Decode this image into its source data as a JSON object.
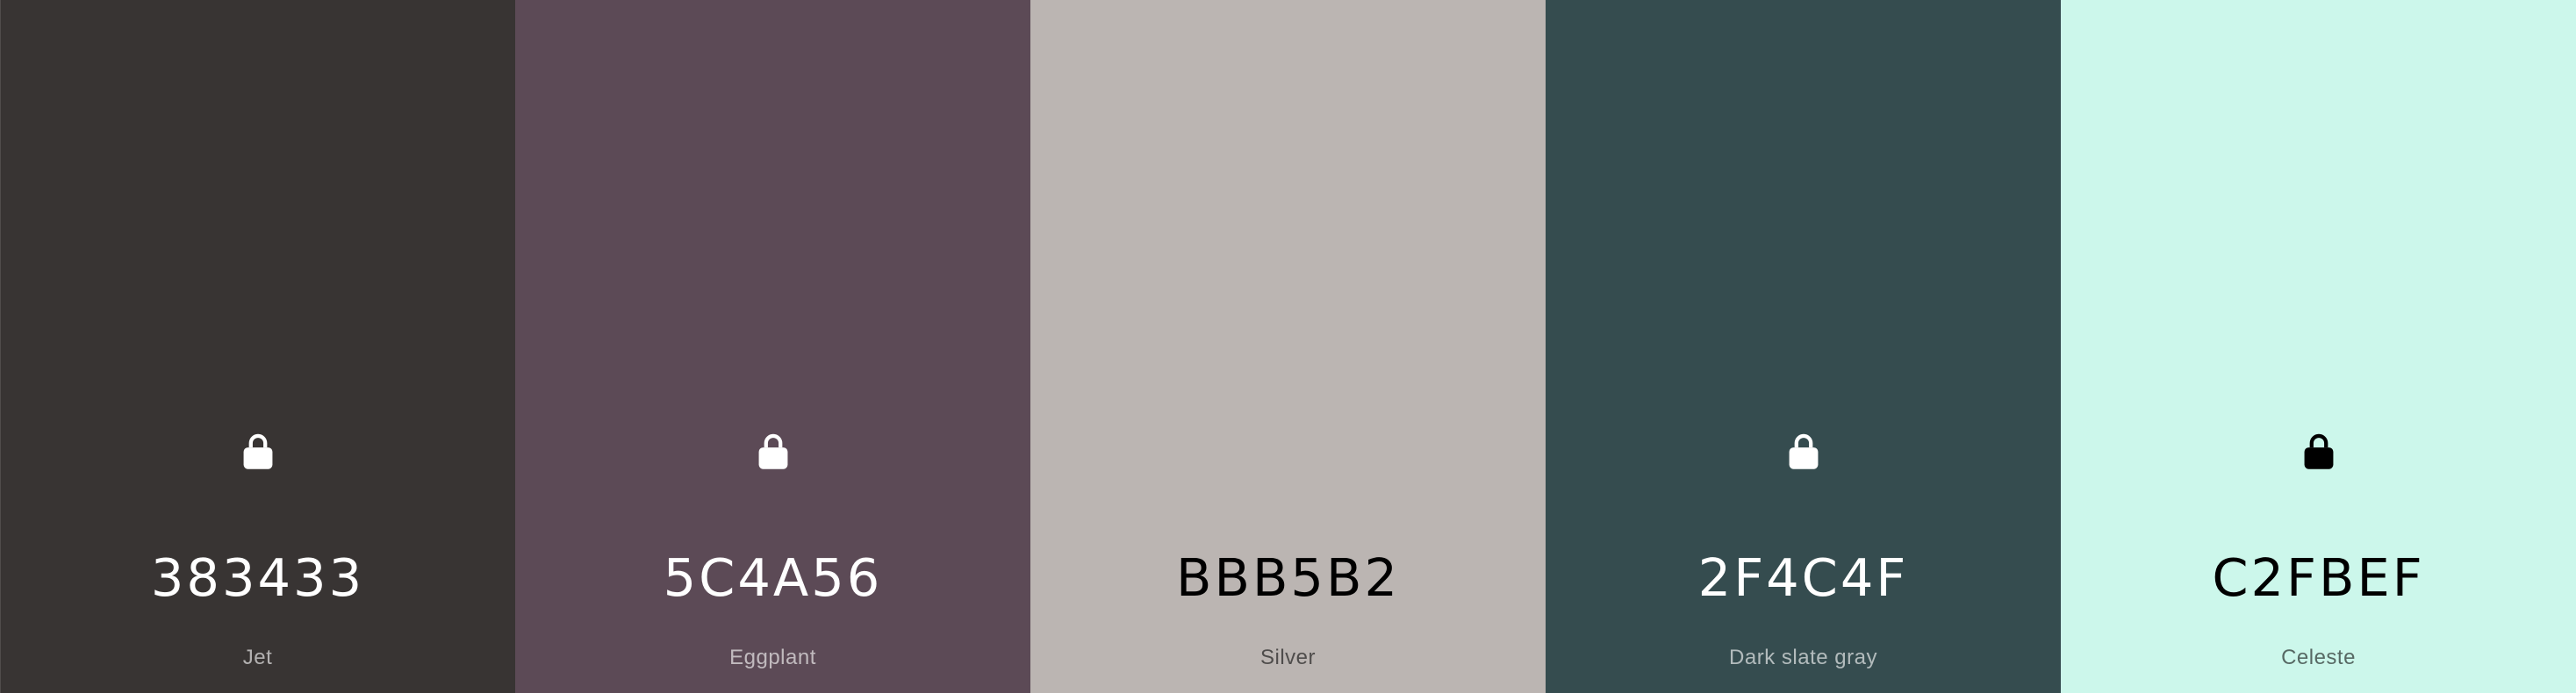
{
  "palette": {
    "colors": [
      {
        "hex": "383433",
        "name": "Jet",
        "bg": "#383433",
        "text_tone": "light",
        "icon": "lock-icon"
      },
      {
        "hex": "5C4A56",
        "name": "Eggplant",
        "bg": "#5C4A56",
        "text_tone": "light",
        "icon": "lock-icon"
      },
      {
        "hex": "BBB5B2",
        "name": "Silver",
        "bg": "#BBB5B2",
        "text_tone": "dark",
        "icon": null
      },
      {
        "hex": "2F4C4F",
        "name": "Dark slate gray",
        "bg": "#354C4F",
        "text_tone": "light",
        "icon": "lock-icon"
      },
      {
        "hex": "C2FBEF",
        "name": "Celeste",
        "bg": "#CCF7EB",
        "text_tone": "dark",
        "icon": "lock-icon"
      }
    ]
  }
}
